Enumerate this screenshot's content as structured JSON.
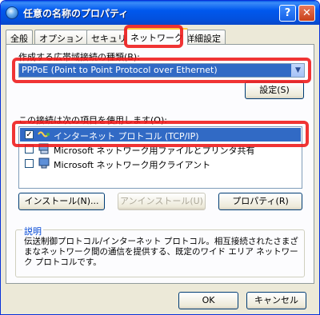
{
  "window": {
    "title": "任意の名称のプロパティ",
    "help_glyph": "?",
    "close_glyph": "✕"
  },
  "tabs": [
    {
      "label": "全般"
    },
    {
      "label": "オプション"
    },
    {
      "label": "セキュリティ"
    },
    {
      "label": "ネットワーク",
      "active": true
    },
    {
      "label": "詳細設定"
    }
  ],
  "connection_type": {
    "label": "作成する広帯域接続の種類(B):",
    "value": "PPPoE (Point to Point Protocol over Ethernet)",
    "settings_button": "設定(S)"
  },
  "components": {
    "label": "この接続は次の項目を使用します(O):",
    "items": [
      {
        "label": "インターネット プロトコル (TCP/IP)",
        "checked": true,
        "selected": true
      },
      {
        "label": "Microsoft ネットワーク用ファイルとプリンタ共有",
        "checked": false,
        "selected": false
      },
      {
        "label": "Microsoft ネットワーク用クライアント",
        "checked": false,
        "selected": false
      }
    ]
  },
  "actions": {
    "install": "インストール(N)...",
    "uninstall": "アンインストール(U)",
    "properties": "プロパティ(R)"
  },
  "description": {
    "label": "説明",
    "text": "伝送制御プロトコル/インターネット プロトコル。相互接続されたさまざまなネットワーク間の通信を提供する、既定のワイド エリア ネットワーク プロトコルです。"
  },
  "dialog": {
    "ok": "OK",
    "cancel": "キャンセル"
  },
  "colors": {
    "selection": "#316ac5",
    "highlight": "#ee1818",
    "titlebar": "#0058ee"
  }
}
